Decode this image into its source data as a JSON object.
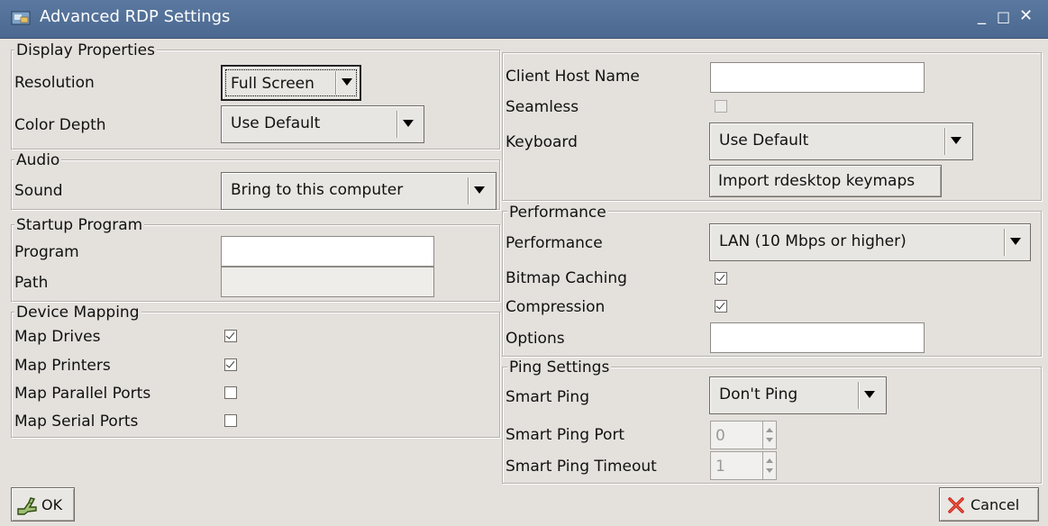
{
  "window": {
    "title": "Advanced RDP Settings",
    "controls": {
      "minimize": "_",
      "maximize": "□",
      "close": "✕"
    }
  },
  "display": {
    "title": "Display Properties",
    "resolution_label": "Resolution",
    "resolution_value": "Full Screen",
    "color_depth_label": "Color Depth",
    "color_depth_value": "Use Default"
  },
  "audio": {
    "title": "Audio",
    "sound_label": "Sound",
    "sound_value": "Bring to this computer"
  },
  "startup": {
    "title": "Startup Program",
    "program_label": "Program",
    "program_value": "",
    "path_label": "Path",
    "path_value": ""
  },
  "device": {
    "title": "Device Mapping",
    "items": [
      {
        "label": "Map Drives",
        "checked": true
      },
      {
        "label": "Map Printers",
        "checked": true
      },
      {
        "label": "Map Parallel Ports",
        "checked": false
      },
      {
        "label": "Map Serial Ports",
        "checked": false
      }
    ]
  },
  "client": {
    "host_label": "Client Host Name",
    "host_value": "",
    "seamless_label": "Seamless",
    "seamless_checked": false,
    "keyboard_label": "Keyboard",
    "keyboard_value": "Use Default",
    "import_button": "Import rdesktop keymaps"
  },
  "performance": {
    "title": "Performance",
    "performance_label": "Performance",
    "performance_value": "LAN (10 Mbps or higher)",
    "bitmap_label": "Bitmap Caching",
    "bitmap_checked": true,
    "compression_label": "Compression",
    "compression_checked": true,
    "options_label": "Options",
    "options_value": ""
  },
  "ping": {
    "title": "Ping Settings",
    "smart_ping_label": "Smart Ping",
    "smart_ping_value": "Don't Ping",
    "port_label": "Smart Ping Port",
    "port_value": "0",
    "timeout_label": "Smart Ping Timeout",
    "timeout_value": "1"
  },
  "buttons": {
    "ok": "OK",
    "cancel": "Cancel"
  }
}
